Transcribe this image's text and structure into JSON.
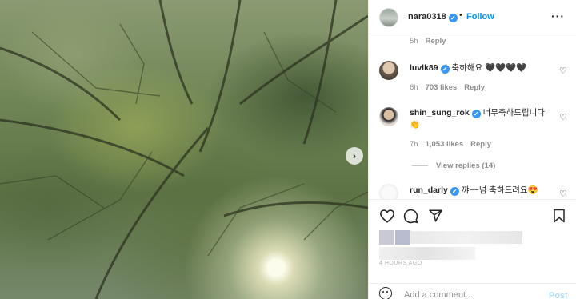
{
  "post": {
    "author": "nara0318",
    "follow_label": "Follow",
    "separator": "•",
    "more_label": "···",
    "next_label": "›"
  },
  "comments": {
    "top_meta": {
      "time": "5h",
      "reply": "Reply"
    },
    "items": [
      {
        "user": "luvlk89",
        "text": "축하해요 🖤🖤🖤🖤",
        "time": "6h",
        "likes": "703 likes",
        "reply": "Reply"
      },
      {
        "user": "shin_sung_rok",
        "text": "너무축하드립니다",
        "extra": "👏",
        "time": "7h",
        "likes": "1,053 likes",
        "reply": "Reply",
        "view_replies": "View replies (14)"
      },
      {
        "user": "run_darly",
        "text": "꺄~~넘 축하드려요😍"
      }
    ],
    "heart_icon": "♡",
    "verified_mark": "✓"
  },
  "actions": {
    "date": "4 HOURS AGO"
  },
  "add_comment": {
    "placeholder": "Add a comment...",
    "post_label": "Post"
  },
  "colors": {
    "link_blue": "#0095f6",
    "verified_blue": "#3897f0",
    "post_disabled": "#b2dffc"
  }
}
